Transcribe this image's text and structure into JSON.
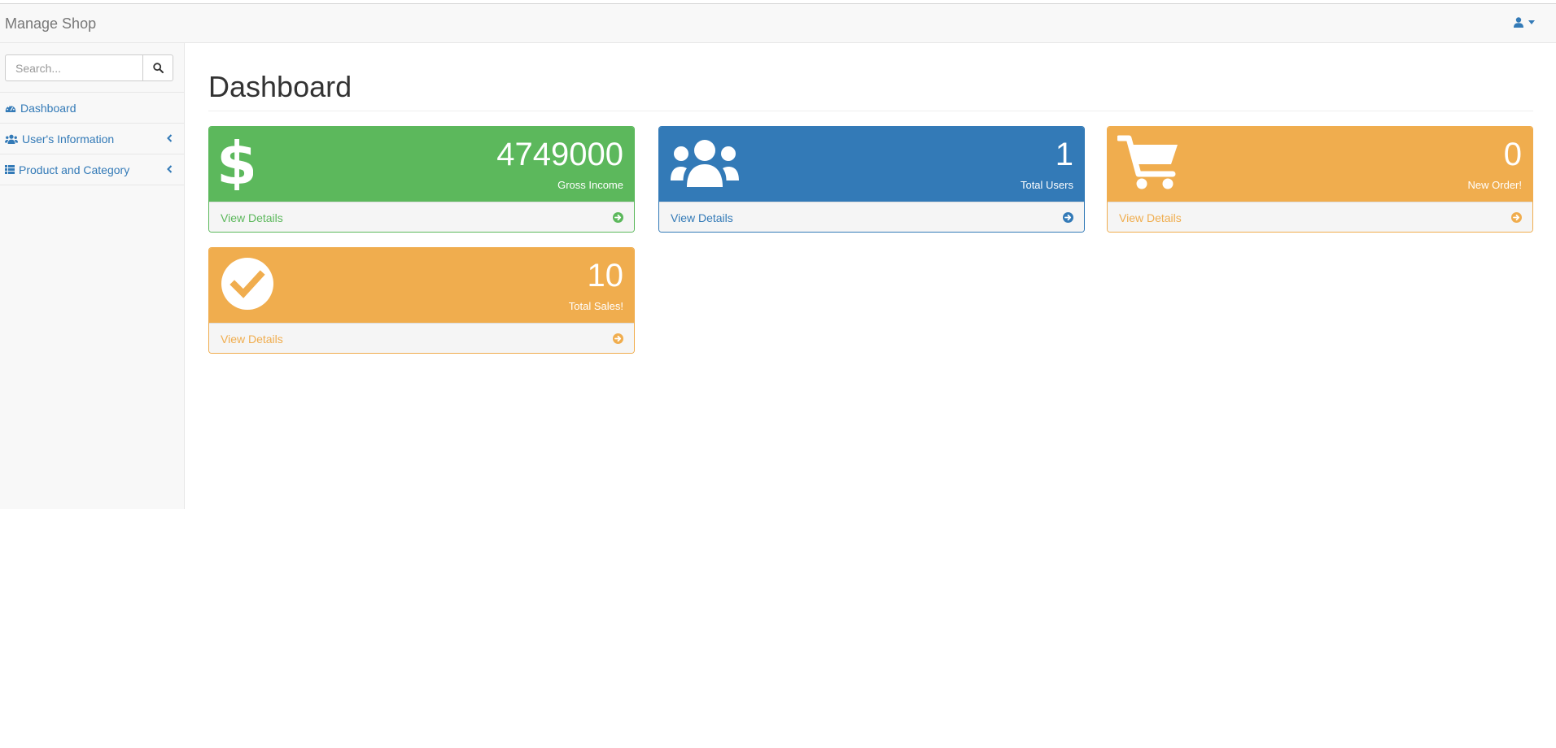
{
  "navbar": {
    "brand": "Manage Shop",
    "user_icon": "user-icon"
  },
  "sidebar": {
    "search_placeholder": "Search...",
    "search_icon": "search-icon",
    "items": [
      {
        "label": "Dashboard",
        "icon": "dashboard-icon"
      },
      {
        "label": "User's Information",
        "icon": "users-icon"
      },
      {
        "label": "Product and Category",
        "icon": "list-icon"
      }
    ]
  },
  "main": {
    "title": "Dashboard",
    "panels": [
      {
        "value": "4749000",
        "label": "Gross Income",
        "link": "View Details",
        "icon": "dollar-icon",
        "color": "#5cb85c"
      },
      {
        "value": "1",
        "label": "Total Users",
        "link": "View Details",
        "icon": "users-icon",
        "color": "#337ab7"
      },
      {
        "value": "0",
        "label": "New Order!",
        "link": "View Details",
        "icon": "shopping-cart-icon",
        "color": "#f0ad4e"
      },
      {
        "value": "10",
        "label": "Total Sales!",
        "link": "View Details",
        "icon": "check-circle-icon",
        "color": "#f0ad4e"
      }
    ]
  }
}
